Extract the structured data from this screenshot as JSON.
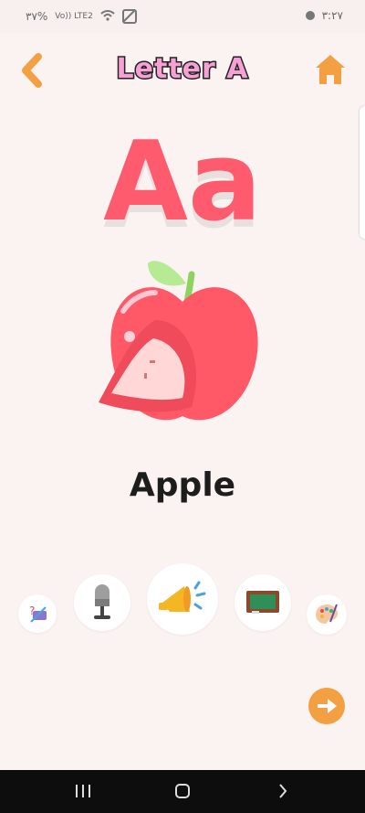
{
  "status": {
    "battery": "٣٧%",
    "network": "Vo)) LTE2",
    "time": "٣:٢٧"
  },
  "header": {
    "title": "Letter A"
  },
  "content": {
    "big_letter": "Aa",
    "word": "Apple"
  },
  "tools": {
    "labels": [
      "quiz-tool",
      "microphone-tool",
      "megaphone-tool",
      "chalkboard-tool",
      "palette-tool"
    ]
  },
  "colors": {
    "accent": "#f3a043",
    "letter": "#ff5b6f",
    "background": "#fbf3f1"
  }
}
